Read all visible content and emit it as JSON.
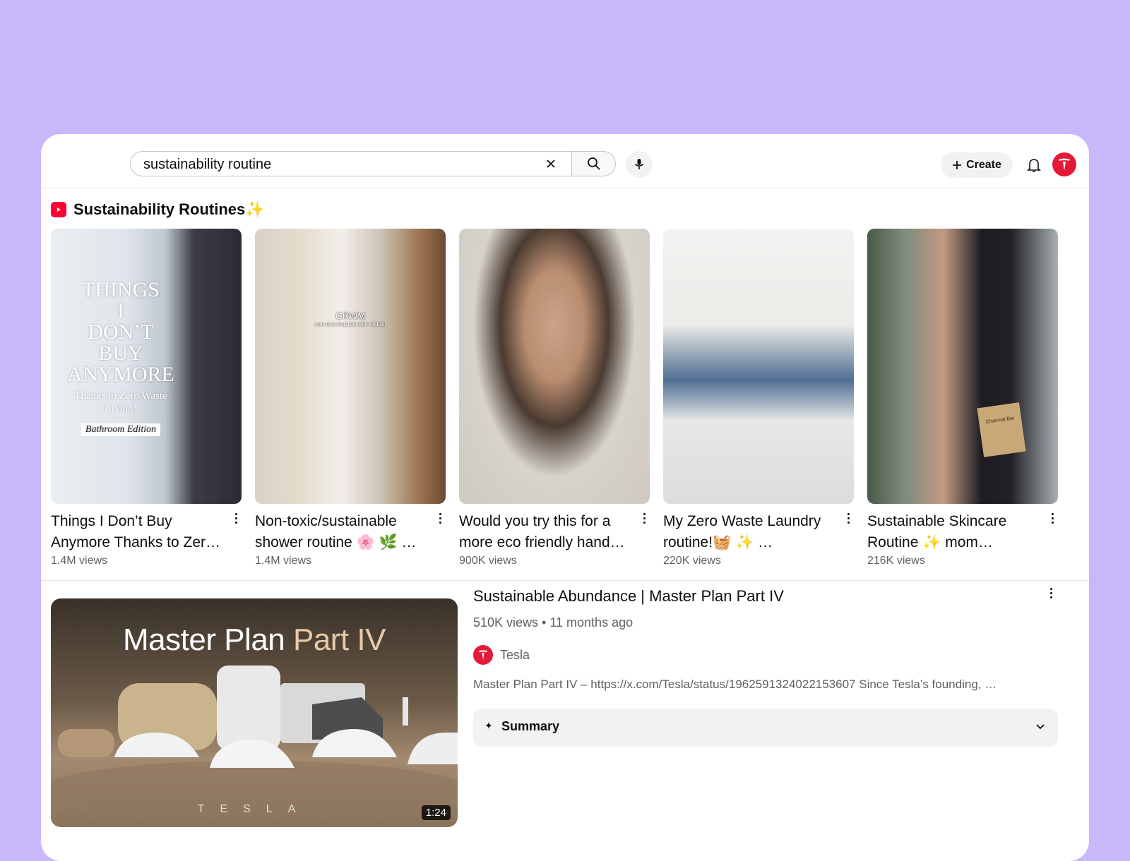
{
  "search": {
    "query": "sustainability routine"
  },
  "header": {
    "create_label": "Create"
  },
  "shelf": {
    "title": "Sustainability Routines",
    "title_emoji": "✨",
    "cards": [
      {
        "title": "Things I Don’t Buy Anymore Thanks to Zer…",
        "views": "1.4M views",
        "overlay": [
          "THINGS",
          "I",
          "DON’T",
          "BUY",
          "ANYMORE",
          "Thanks to Zero Waste",
          "Living!",
          "Bathroom Edition"
        ]
      },
      {
        "title": "Non-toxic/sustainable shower routine 🌸 🌿 …",
        "views": "1.4M views",
        "overlay": [
          "GRWM",
          "non-toxic/sustainable edition"
        ]
      },
      {
        "title": "Would you try this for a more eco friendly hand…",
        "views": "900K views"
      },
      {
        "title": "My Zero Waste Laundry routine!🧺 ✨ …",
        "views": "220K views"
      },
      {
        "title": "Sustainable Skincare Routine ✨ mom…",
        "views": "216K views",
        "overlay": [
          "Charcoal Bar"
        ]
      }
    ]
  },
  "result": {
    "title": "Sustainable Abundance | Master Plan Part IV",
    "meta": "510K views • 11 months ago",
    "channel": "Tesla",
    "description": "Master Plan Part IV – https://x.com/Tesla/status/1962591324022153607 Since Tesla’s founding, …",
    "thumb_title_a": "Master Plan ",
    "thumb_title_b": "Part IV",
    "thumb_wordmark": "TESLA",
    "duration": "1:24",
    "summary_label": "Summary"
  },
  "colors": {
    "background": "#c8b8fb",
    "brand_red": "#e31937",
    "shorts_red": "#ff0033"
  }
}
